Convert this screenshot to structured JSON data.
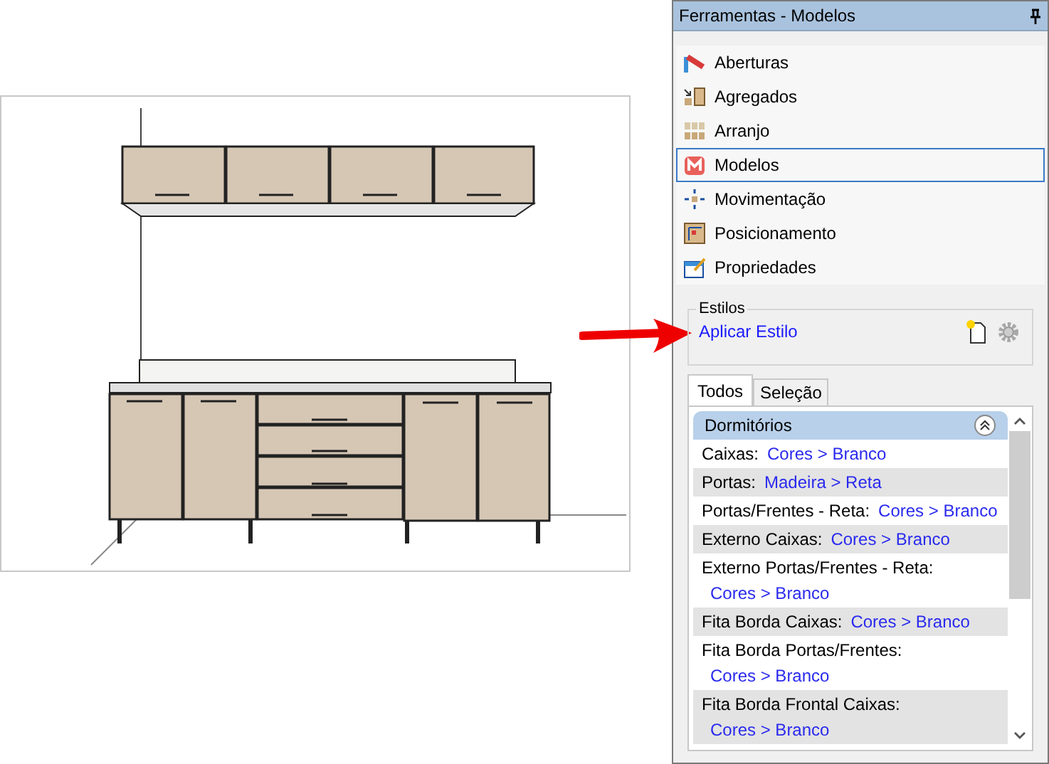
{
  "panel": {
    "title": "Ferramentas - Modelos",
    "pinned": true
  },
  "tools": [
    {
      "label": "Aberturas",
      "kind": "aberturas",
      "selected": false
    },
    {
      "label": "Agregados",
      "kind": "agregados",
      "selected": false
    },
    {
      "label": "Arranjo",
      "kind": "arranjo",
      "selected": false
    },
    {
      "label": "Modelos",
      "kind": "modelos",
      "selected": true
    },
    {
      "label": "Movimentação",
      "kind": "movimentacao",
      "selected": false
    },
    {
      "label": "Posicionamento",
      "kind": "posicionamento",
      "selected": false
    },
    {
      "label": "Propriedades",
      "kind": "propriedades",
      "selected": false
    }
  ],
  "styles_group": {
    "legend": "Estilos",
    "link": "Aplicar Estilo"
  },
  "tabs": [
    {
      "label": "Todos",
      "selected": true
    },
    {
      "label": "Seleção",
      "selected": false
    }
  ],
  "style_list": {
    "group": "Dormitórios",
    "expanded": true,
    "rows": [
      {
        "label": "Caixas:",
        "value": "Cores > Branco"
      },
      {
        "label": "Portas:",
        "value": "Madeira > Reta"
      },
      {
        "label": "Portas/Frentes - Reta:",
        "value": "Cores > Branco"
      },
      {
        "label": "Externo Caixas:",
        "value": "Cores > Branco"
      },
      {
        "label": "Externo Portas/Frentes - Reta:",
        "value": "Cores > Branco"
      },
      {
        "label": "Fita Borda Caixas:",
        "value": "Cores > Branco"
      },
      {
        "label": "Fita Borda Portas/Frentes:",
        "value": "Cores > Branco"
      },
      {
        "label": "Fita Borda Frontal Caixas:",
        "value": "Cores > Branco"
      }
    ]
  }
}
